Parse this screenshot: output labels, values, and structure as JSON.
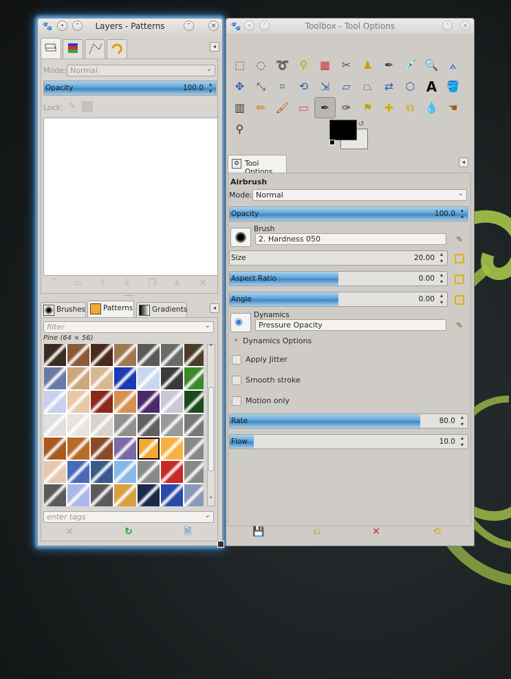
{
  "layers_window": {
    "title": "Layers - Patterns",
    "mode_label": "Mode:",
    "mode_value": "Normal",
    "opacity_label": "Opacity",
    "opacity_value": "100.0",
    "opacity_level": 1.0,
    "lock_label": "Lock:",
    "resource_tabs": [
      "Brushes",
      "Patterns",
      "Gradients"
    ],
    "filter_placeholder": "filter",
    "pattern_name": "Pine (64 × 56)",
    "tags_placeholder": "enter tags",
    "selected_pattern_index": 32
  },
  "toolbox_window": {
    "title": "Toolbox - Tool Options",
    "tool_options_tab": "Tool Options",
    "tool_name": "Airbrush",
    "mode_label": "Mode:",
    "mode_value": "Normal",
    "opacity_label": "Opacity",
    "opacity_value": "100.0",
    "opacity_level": 1.0,
    "brush_label": "Brush",
    "brush_value": "2. Hardness 050",
    "size_label": "Size",
    "size_value": "20.00",
    "size_level": 0.0,
    "aspect_label": "Aspect Ratio",
    "aspect_value": "0.00",
    "aspect_level": 0.5,
    "angle_label": "Angle",
    "angle_value": "0.00",
    "angle_level": 0.5,
    "dynamics_label": "Dynamics",
    "dynamics_value": "Pressure Opacity",
    "dynamics_options": "Dynamics Options",
    "apply_jitter": "Apply Jitter",
    "smooth_stroke": "Smooth stroke",
    "motion_only": "Motion only",
    "rate_label": "Rate",
    "rate_value": "80.0",
    "rate_level": 0.8,
    "flow_label": "Flow",
    "flow_value": "10.0",
    "flow_level": 0.1
  },
  "colors": {
    "selection_fill": "#5fa4d6",
    "foreground": "#000000",
    "background": "#e9e7e4",
    "chain_yellow": "#e0b400",
    "desktop_logo": "#a4c44a"
  }
}
